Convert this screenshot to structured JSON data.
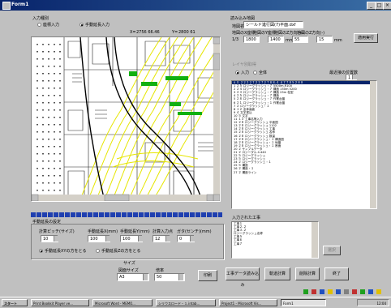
{
  "window": {
    "title": "Form1"
  },
  "input_mode": {
    "header": "入力種別",
    "options": [
      "座標入力",
      "手動延長入力"
    ],
    "selected": 1
  },
  "map_coords": {
    "x_label": "X=",
    "x_value": "2756 66.46",
    "y_label": "Y=",
    "y_value": "2800 61"
  },
  "file_panel": {
    "header": "読み込み地図",
    "filename_label": "地図名",
    "filename_value": "シールド進行図(7)平面.dxf",
    "scale_label": "縮尺",
    "scale_value": "1/3",
    "col_labels": [
      "地図のX座標",
      "地図のY座標",
      "地図のZ方向(+)",
      "地図のZ方向(-)"
    ],
    "col_values": [
      "1800",
      "1400",
      "55",
      "15"
    ],
    "units": [
      "mm",
      "mm"
    ],
    "apply_label": "適用実行"
  },
  "layer_panel": {
    "header": "レイヤ別取得",
    "options": [
      "入力",
      "全体"
    ],
    "selected": 0,
    "hide_label": "最近接の位置数",
    "hide_value": "1"
  },
  "layers": [
    "0 ０ ２２２２７２２７２７８８.４ ４７７８５２８８",
    "1 ２５ ロジーグラッシュ・７ 5500m,R100",
    "2 ２４ ロジーグラッシュ・７ 構造 150m 5200",
    "3 ２３ ロジーグラッシュ・７ 構造 25m 柱型",
    "4 ２５ ロジーグラッシュ・７ 構造",
    "5 ２８ ロジーグラッシュ・７ 作業台盤",
    "6 ２１ ロジーグラッシュ・１ 作業台盤",
    "7 ２ ロジーグラッシュ・１",
    "8 １２ 全体画面",
    "9 ４ 文字書込",
    "10 ５ 文字",
    "11 １３ 工事名等入力",
    "12 ２８ ロジーグラッシュ 平面図",
    "13 ２８ ロジーグラッシュ 1102",
    "14 ２８ ロジーグラッシュ 工事",
    "15 ２８ ロジーグラッシュ 名称",
    "16 ２８ ロジーグラッシュ 数量",
    "17 ２８ ロジーグラッシュ・１ 構造図",
    "18 ２８ ロジーグラッシュ・１ 地盤",
    "19 ２８ ロジーグラッシュ・１ 断面",
    "20 ２ サンプルデータ",
    "21 ２ ロジーダル 4.440",
    "22 ５ ロジーグラッシュ",
    "23 ５ ロジーグラッシュ",
    "24 ２ ロジーグラッシュ・１",
    "25 ５ 構造",
    "26 ２ 構造・１",
    "27 ２ 構造ライン"
  ],
  "layer_selected": 0,
  "select_panel": {
    "header": "入力された工事",
    "items": [
      "工事１",
      "工事２-２",
      "工事３-２",
      "ロジーグラッシュ名称",
      "工事５",
      "工事６",
      "工事７"
    ],
    "select_button": "選択"
  },
  "manual_panel": {
    "header": "手動延長の設定",
    "col_labels": [
      "計算ピッチ(サイズ)",
      "手動延長X(mm)",
      "手動延長Y(mm)",
      "計算入力点",
      "ガタ(センチ)(mm)"
    ],
    "col_values": [
      "10",
      "100",
      "100",
      "12",
      "0"
    ],
    "check_options": [
      "手動延長XYの方をとる",
      "手動延長Zの方をとる"
    ],
    "check_selected": 0
  },
  "size_panel": {
    "header": "サイズ",
    "labels": [
      "図面サイズ",
      "倍率"
    ],
    "values": [
      "A3",
      "50"
    ],
    "apply_button": "印刷"
  },
  "bottom_buttons": [
    "工事データ読み込み",
    "軌道計算",
    "削除計算",
    "終了"
  ],
  "taskbar": {
    "start": "スタート",
    "tasks": [
      "Print Bookkit Player ve...",
      "Microsoft Word - MEMO...",
      "シリウスロード・１.intab...",
      "Project1 - Microsoft Vis...",
      "Form1"
    ],
    "clock": "12:04"
  },
  "colors": {
    "title_start": "#08246b",
    "title_end": "#3a6ea5",
    "selection": "#08246b",
    "progress": "#1f3fb0",
    "map_yellow": "#e6e600",
    "map_green": "#10b010"
  }
}
